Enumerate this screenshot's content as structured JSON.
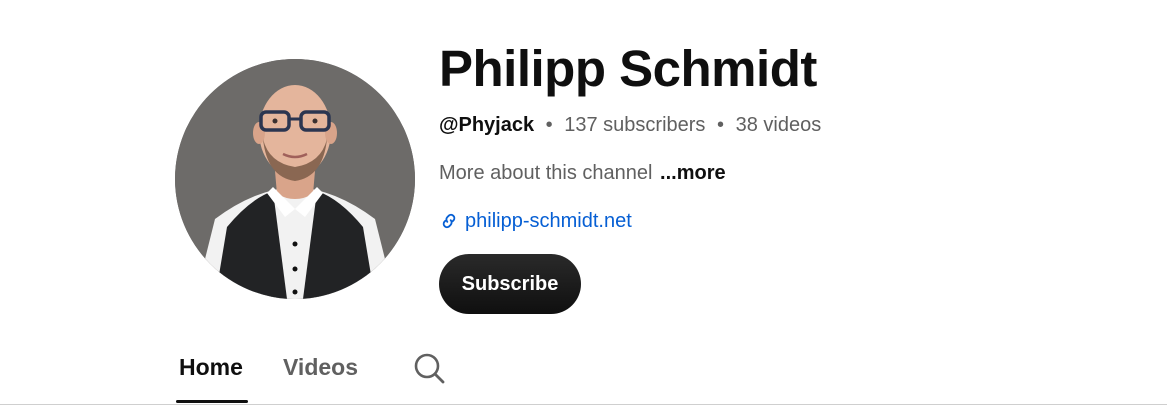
{
  "channel": {
    "name": "Philipp Schmidt",
    "handle": "@Phyjack",
    "separator": "•",
    "subscribers": "137 subscribers",
    "videos": "38 videos",
    "description": "More about this channel",
    "more_label": "...more",
    "link_text": "philipp-schmidt.net"
  },
  "actions": {
    "subscribe_label": "Subscribe"
  },
  "tabs": [
    {
      "label": "Home",
      "active": true
    },
    {
      "label": "Videos",
      "active": false
    }
  ],
  "icons": {
    "link": "link-icon",
    "search": "search-icon"
  },
  "colors": {
    "link": "#065fd4",
    "text_primary": "#0f0f0f",
    "text_secondary": "#606060",
    "button_bg": "#0f0f0f"
  }
}
